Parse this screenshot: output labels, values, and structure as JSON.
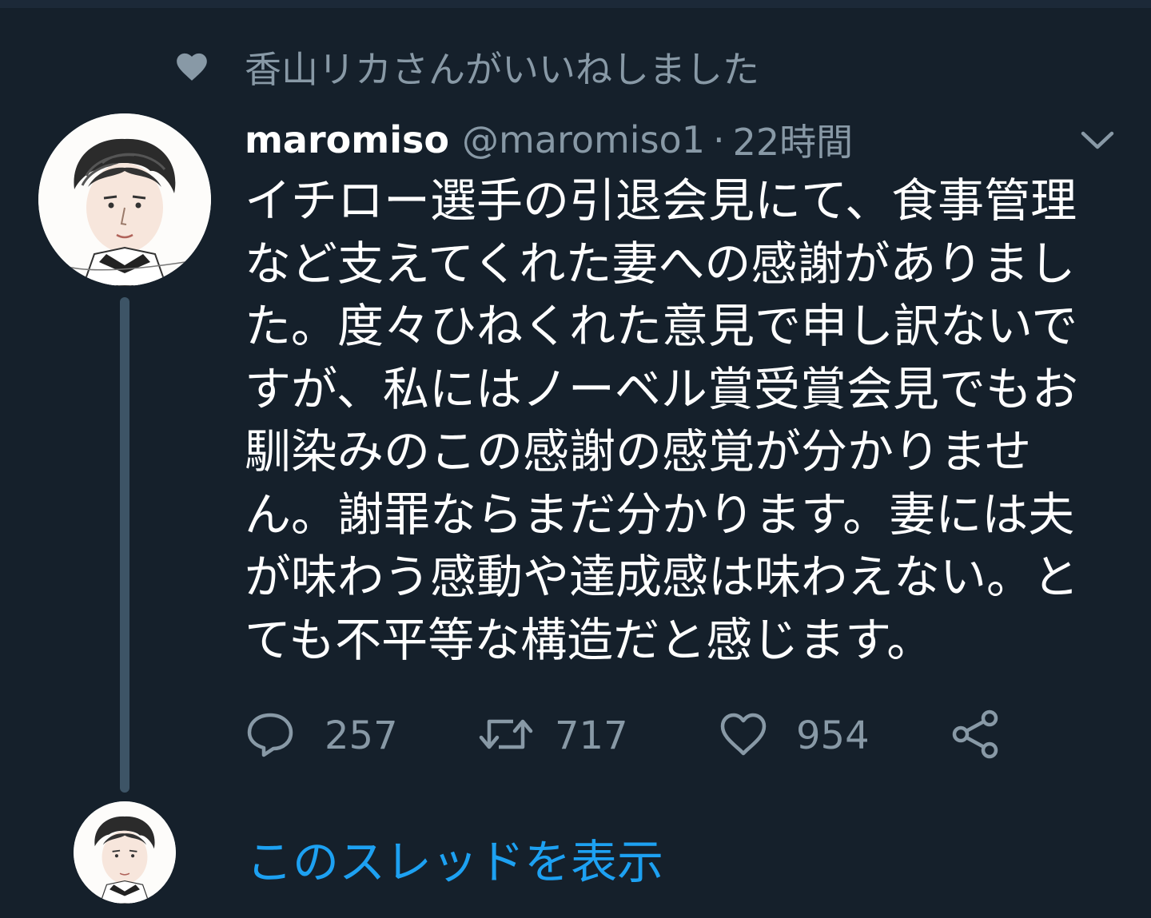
{
  "social_context": {
    "icon": "heart-icon",
    "text": "香山リカさんがいいねしました"
  },
  "tweet": {
    "display_name": "maromiso",
    "handle": "@maromiso1",
    "separator": "·",
    "time": "22時間",
    "text": "イチロー選手の引退会見にて、食事管理\nなど支えてくれた妻への感謝がありまし\nた。度々ひねくれた意見で申し訳ないで\nすが、私にはノーベル賞受賞会見でもお\n馴染みのこの感謝の感覚が分かりませ\nん。謝罪ならまだ分かります。妻には夫\nが味わう感動や達成感は味わえない。と\nても不平等な構造だと感じます。",
    "actions": {
      "reply_count": "257",
      "retweet_count": "717",
      "like_count": "954"
    }
  },
  "show_thread": {
    "label": "このスレッドを表示"
  },
  "colors": {
    "background": "#15202b",
    "muted_text": "#8899a6",
    "primary_text": "#ffffff",
    "link": "#1da1f2",
    "thread_line": "#3d5466"
  }
}
